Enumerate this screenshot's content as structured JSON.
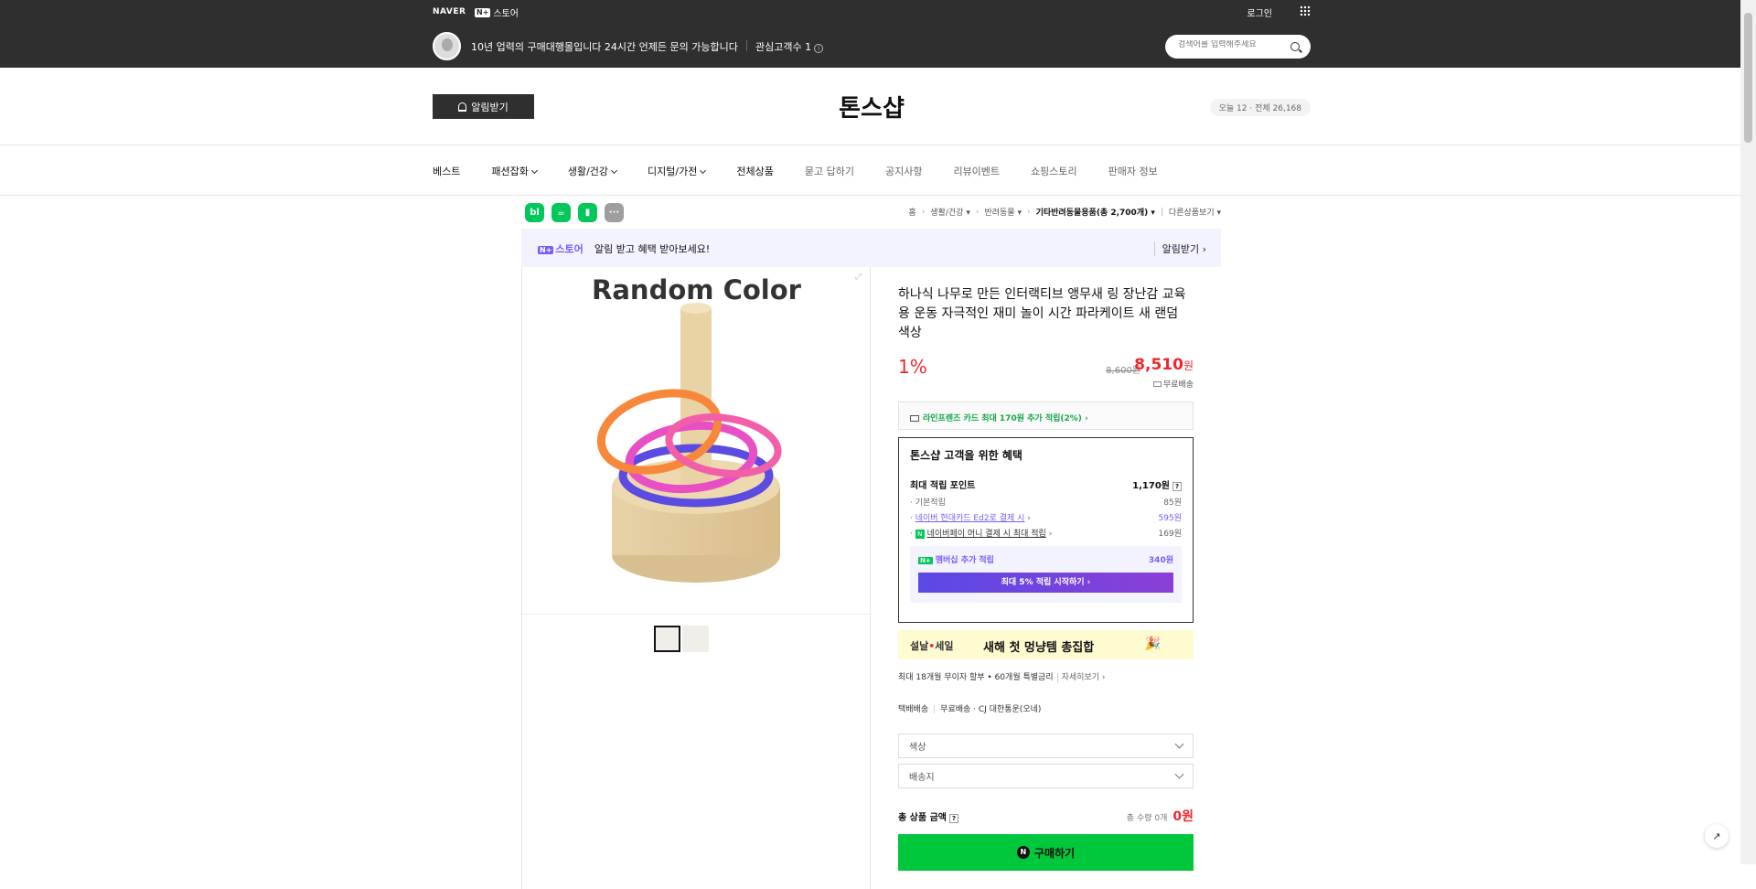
{
  "topbar": {
    "naver": "NAVER",
    "store_box": "N+",
    "store": "스토어",
    "login": "로그인",
    "shop_desc": "10년 업력의 구매대행몰입니다 24시간 언제든 문의 가능합니다",
    "fav": "관심고객수 1",
    "search_placeholder": "검색어를 입력해주세요"
  },
  "header": {
    "alarm": "알림받기",
    "shop_name": "톤스샵",
    "visitors": "오늘 12 · 전체 26,168"
  },
  "nav": {
    "items": [
      {
        "label": "베스트",
        "dropdown": false
      },
      {
        "label": "패션잡화",
        "dropdown": true
      },
      {
        "label": "생활/건강",
        "dropdown": true
      },
      {
        "label": "디지털/가전",
        "dropdown": true
      },
      {
        "label": "전체상품",
        "dropdown": false
      },
      {
        "label": "묻고 답하기",
        "dropdown": false
      },
      {
        "label": "공지사항",
        "dropdown": false
      },
      {
        "label": "리뷰이벤트",
        "dropdown": false
      },
      {
        "label": "쇼핑스토리",
        "dropdown": false
      },
      {
        "label": "판매자 정보",
        "dropdown": false
      }
    ]
  },
  "quick_icons": [
    {
      "label": "bl",
      "color": "#03c75a"
    },
    {
      "label": "☕",
      "color": "#03c75a"
    },
    {
      "label": "▮",
      "color": "#03c75a"
    },
    {
      "label": "···",
      "color": "#9e9e9e"
    }
  ],
  "breadcrumb": {
    "home": "홈",
    "c1": "생활/건강",
    "c2": "반려동물",
    "c3": "기타반려동물용품(총 2,700개)",
    "c4": "다른상품보기"
  },
  "promo": {
    "box": "N+",
    "store": "스토어",
    "text": "알림 받고 혜택 받아보세요!",
    "button": "알림받기"
  },
  "product": {
    "image_caption": "Random Color",
    "title": "하나식 나무로 만든 인터랙티브 앵무새 링 장난감 교육용 운동 자극적인 재미 놀이 시간 파라케이트 새 랜덤 색상",
    "discount": "1%",
    "original_price": "8,600원",
    "sale_price": "8,510",
    "won": "원",
    "shipping": "무료배송",
    "card_promo": "라인프렌즈 카드 최대 170원 추가 적립(2%)"
  },
  "benefit": {
    "title": "톤스샵 고객을 위한 혜택",
    "max_point_label": "최대 적립 포인트",
    "max_point": "1,170원",
    "base_label": "기본적립",
    "base": "85원",
    "card_label": "네이버 현대카드 Ed2로 결제 시",
    "card": "595원",
    "pay_label": "네이버페이 머니 결제 시 최대 적립",
    "pay": "169원",
    "member_label": "멤버십 추가 적립",
    "member": "340원",
    "member_btn": "최대 5% 적립 시작하기"
  },
  "sale_banner": {
    "tag1": "설날",
    "tag2": "세일",
    "text": "새해 첫 멍냥템 총집합"
  },
  "installment": {
    "text": "최대 18개월 무이자 할부 • 60개월 특별금리",
    "more": "자세히보기"
  },
  "delivery": {
    "type": "택배배송",
    "fee": "무료배송",
    "carrier": "CJ 대한통운(오네)"
  },
  "options": [
    {
      "label": "색상"
    },
    {
      "label": "배송지"
    }
  ],
  "total": {
    "label": "총 상품 금액",
    "qty": "총 수량 0개",
    "amount": "0원"
  },
  "buy_button": "구매하기"
}
